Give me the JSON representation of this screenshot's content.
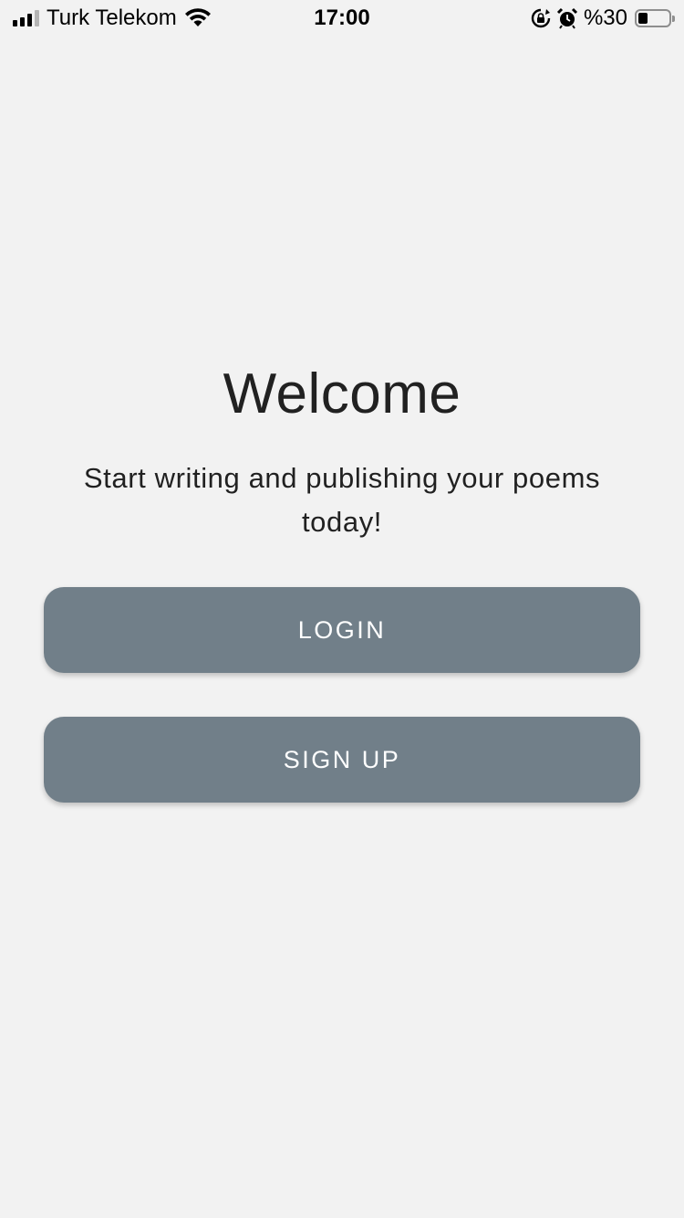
{
  "status_bar": {
    "carrier": "Turk Telekom",
    "time": "17:00",
    "battery_percent": "%30",
    "battery_level": 0.3,
    "icons": [
      "signal-icon",
      "wifi-icon",
      "rotation-lock-icon",
      "alarm-icon",
      "battery-icon"
    ]
  },
  "welcome": {
    "title": "Welcome",
    "subtitle": "Start writing and publishing your poems today!"
  },
  "buttons": {
    "login": "LOGIN",
    "signup": "SIGN UP"
  },
  "colors": {
    "background": "#f2f2f2",
    "button": "#717f89",
    "button_text": "#ffffff",
    "text": "#212121"
  }
}
